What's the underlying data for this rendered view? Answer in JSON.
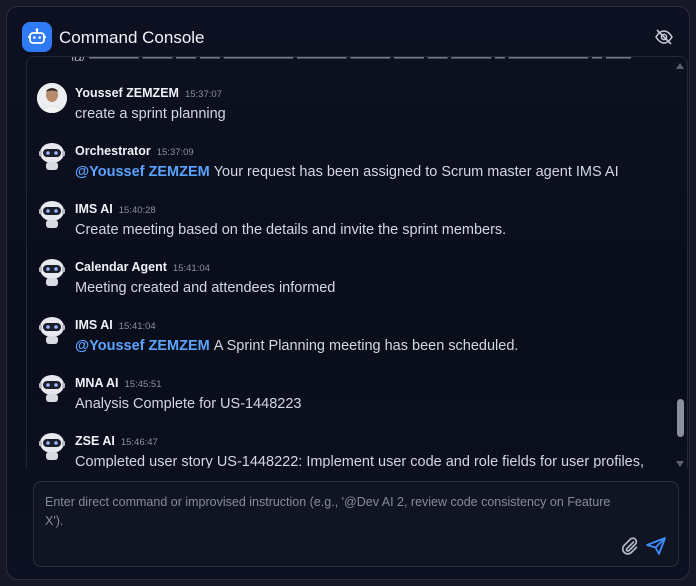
{
  "header": {
    "title": "Command Console",
    "app_icon": "robot-icon",
    "hide_icon": "eye-off-icon"
  },
  "messages": [
    {
      "author": "Youssef ZEMZEM",
      "time": "15:37:07",
      "avatar": "user-photo",
      "mention": "",
      "text": "create a sprint planning"
    },
    {
      "author": "Orchestrator",
      "time": "15:37:09",
      "avatar": "robot-avatar",
      "mention": "@Youssef ZEMZEM",
      "text": "Your request has been assigned to Scrum master agent IMS AI"
    },
    {
      "author": "IMS AI",
      "time": "15:40:28",
      "avatar": "robot-avatar",
      "mention": "",
      "text": "Create meeting based on the details and invite the sprint members."
    },
    {
      "author": "Calendar Agent",
      "time": "15:41:04",
      "avatar": "robot-avatar",
      "mention": "",
      "text": "Meeting created and attendees informed"
    },
    {
      "author": "IMS AI",
      "time": "15:41:04",
      "avatar": "robot-avatar",
      "mention": "@Youssef ZEMZEM",
      "text": "A Sprint Planning meeting has been scheduled."
    },
    {
      "author": "MNA AI",
      "time": "15:45:51",
      "avatar": "robot-avatar",
      "mention": "",
      "text": "Analysis Complete for US-1448223"
    },
    {
      "author": "ZSE AI",
      "time": "15:46:47",
      "avatar": "robot-avatar",
      "mention": "",
      "text": "Completed user story US-1448222: Implement user code and role fields for user profiles,"
    }
  ],
  "input": {
    "placeholder": "Enter direct command or improvised instruction (e.g., '@Dev AI 2, review code consistency on Feature X').",
    "value": "",
    "attach_icon": "paperclip-icon",
    "send_icon": "send-icon"
  },
  "colors": {
    "accent": "#2f7bf6",
    "mention": "#5aa3ff",
    "background": "#0b0f1d"
  }
}
